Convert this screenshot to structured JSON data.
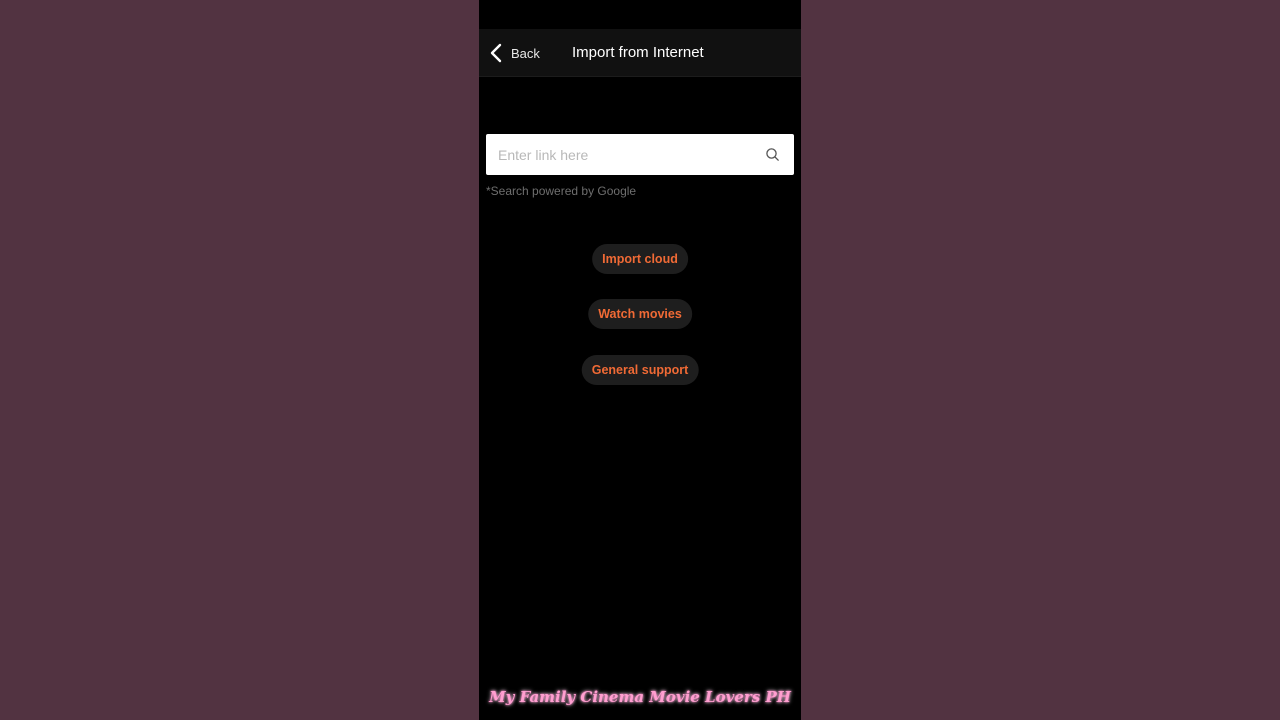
{
  "header": {
    "back_label": "Back",
    "title": "Import from Internet",
    "back_icon": "chevron-left-icon"
  },
  "search": {
    "value": "",
    "placeholder": "Enter link here",
    "icon": "search-icon",
    "note": "*Search powered by Google"
  },
  "actions": [
    {
      "label": "Import cloud"
    },
    {
      "label": "Watch movies"
    },
    {
      "label": "General support"
    }
  ],
  "watermark": {
    "text": "My Family Cinema Movie Lovers PH"
  },
  "colors": {
    "backdrop": "#523341",
    "screen": "#000000",
    "header": "#111111",
    "accent": "#f06a35",
    "pill": "#1e1e1e",
    "watermark": "#ff9fd0"
  }
}
